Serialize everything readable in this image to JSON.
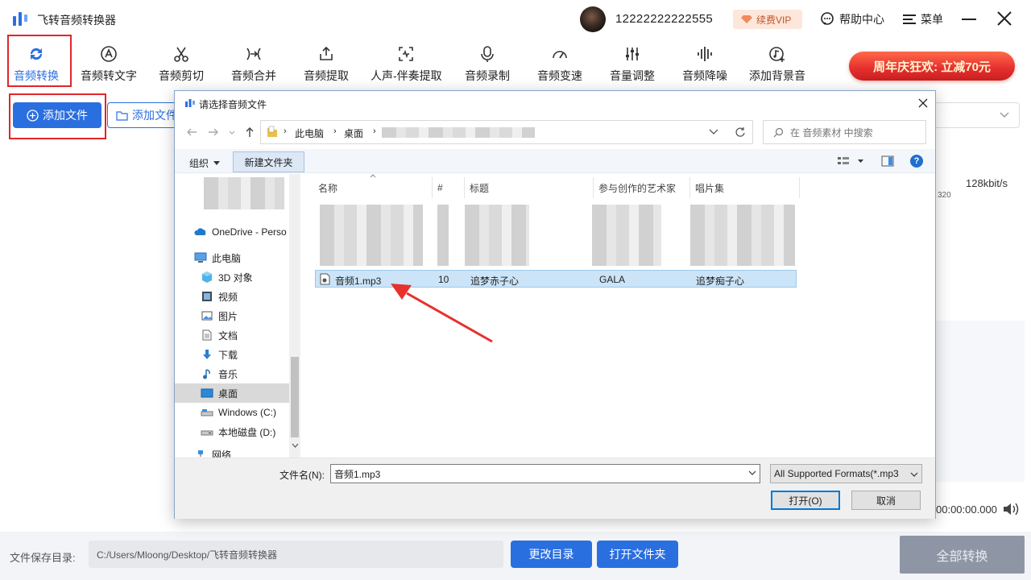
{
  "app": {
    "title": "飞转音频转换器",
    "account": "12222222222555",
    "vip_label": "续费VIP",
    "help_label": "帮助中心",
    "menu_label": "菜单",
    "promo_label": "周年庆狂欢: 立减70元"
  },
  "toolbar": {
    "tools": [
      {
        "label": "音频转换",
        "icon": "refresh-icon",
        "active": true
      },
      {
        "label": "音频转文字",
        "icon": "text-a-icon"
      },
      {
        "label": "音频剪切",
        "icon": "scissors-icon"
      },
      {
        "label": "音频合并",
        "icon": "merge-icon"
      },
      {
        "label": "音频提取",
        "icon": "extract-icon"
      },
      {
        "label": "人声-伴奏提取",
        "icon": "voice-scan-icon"
      },
      {
        "label": "音频录制",
        "icon": "microphone-icon"
      },
      {
        "label": "音频变速",
        "icon": "speedometer-icon"
      },
      {
        "label": "音量调整",
        "icon": "equalizer-icon"
      },
      {
        "label": "音频降噪",
        "icon": "waveform-icon"
      },
      {
        "label": "添加背景音",
        "icon": "music-add-icon"
      }
    ]
  },
  "actions": {
    "add_file": "添加文件",
    "add_folder": "添加文件"
  },
  "background": {
    "bitrate": "128kbit/s",
    "bitrate_small": "320",
    "time": "00:00:00.000"
  },
  "bottom": {
    "save_label": "文件保存目录:",
    "save_path": "C:/Users/Mloong/Desktop/飞转音频转换器",
    "change_dir": "更改目录",
    "open_folder": "打开文件夹",
    "convert_all": "全部转换"
  },
  "dialog": {
    "title": "请选择音频文件",
    "address": {
      "pc": "此电脑",
      "desktop": "桌面"
    },
    "search_placeholder": "在 音频素材 中搜索",
    "organize": "组织",
    "new_folder": "新建文件夹",
    "nav_items": [
      {
        "label": "OneDrive - Perso",
        "icon": "onedrive-icon"
      },
      {
        "label": "此电脑",
        "icon": "computer-icon"
      },
      {
        "label": "3D 对象",
        "icon": "cube-icon"
      },
      {
        "label": "视频",
        "icon": "video-icon"
      },
      {
        "label": "图片",
        "icon": "picture-icon"
      },
      {
        "label": "文档",
        "icon": "document-icon"
      },
      {
        "label": "下载",
        "icon": "download-icon"
      },
      {
        "label": "音乐",
        "icon": "music-icon"
      },
      {
        "label": "桌面",
        "icon": "desktop-icon",
        "selected": true
      },
      {
        "label": "Windows (C:)",
        "icon": "drive-icon"
      },
      {
        "label": "本地磁盘 (D:)",
        "icon": "drive-icon"
      },
      {
        "label": "网络",
        "icon": "network-icon"
      }
    ],
    "columns": [
      "名称",
      "#",
      "标题",
      "参与创作的艺术家",
      "唱片集"
    ],
    "selected_row": {
      "name": "音频1.mp3",
      "number": "10",
      "title": "追梦赤子心",
      "artist": "GALA",
      "album": "追梦痴子心"
    },
    "filename_label": "文件名(N):",
    "filename_value": "音频1.mp3",
    "format": "All Supported Formats(*.mp3",
    "open_button": "打开(O)",
    "cancel_button": "取消"
  }
}
